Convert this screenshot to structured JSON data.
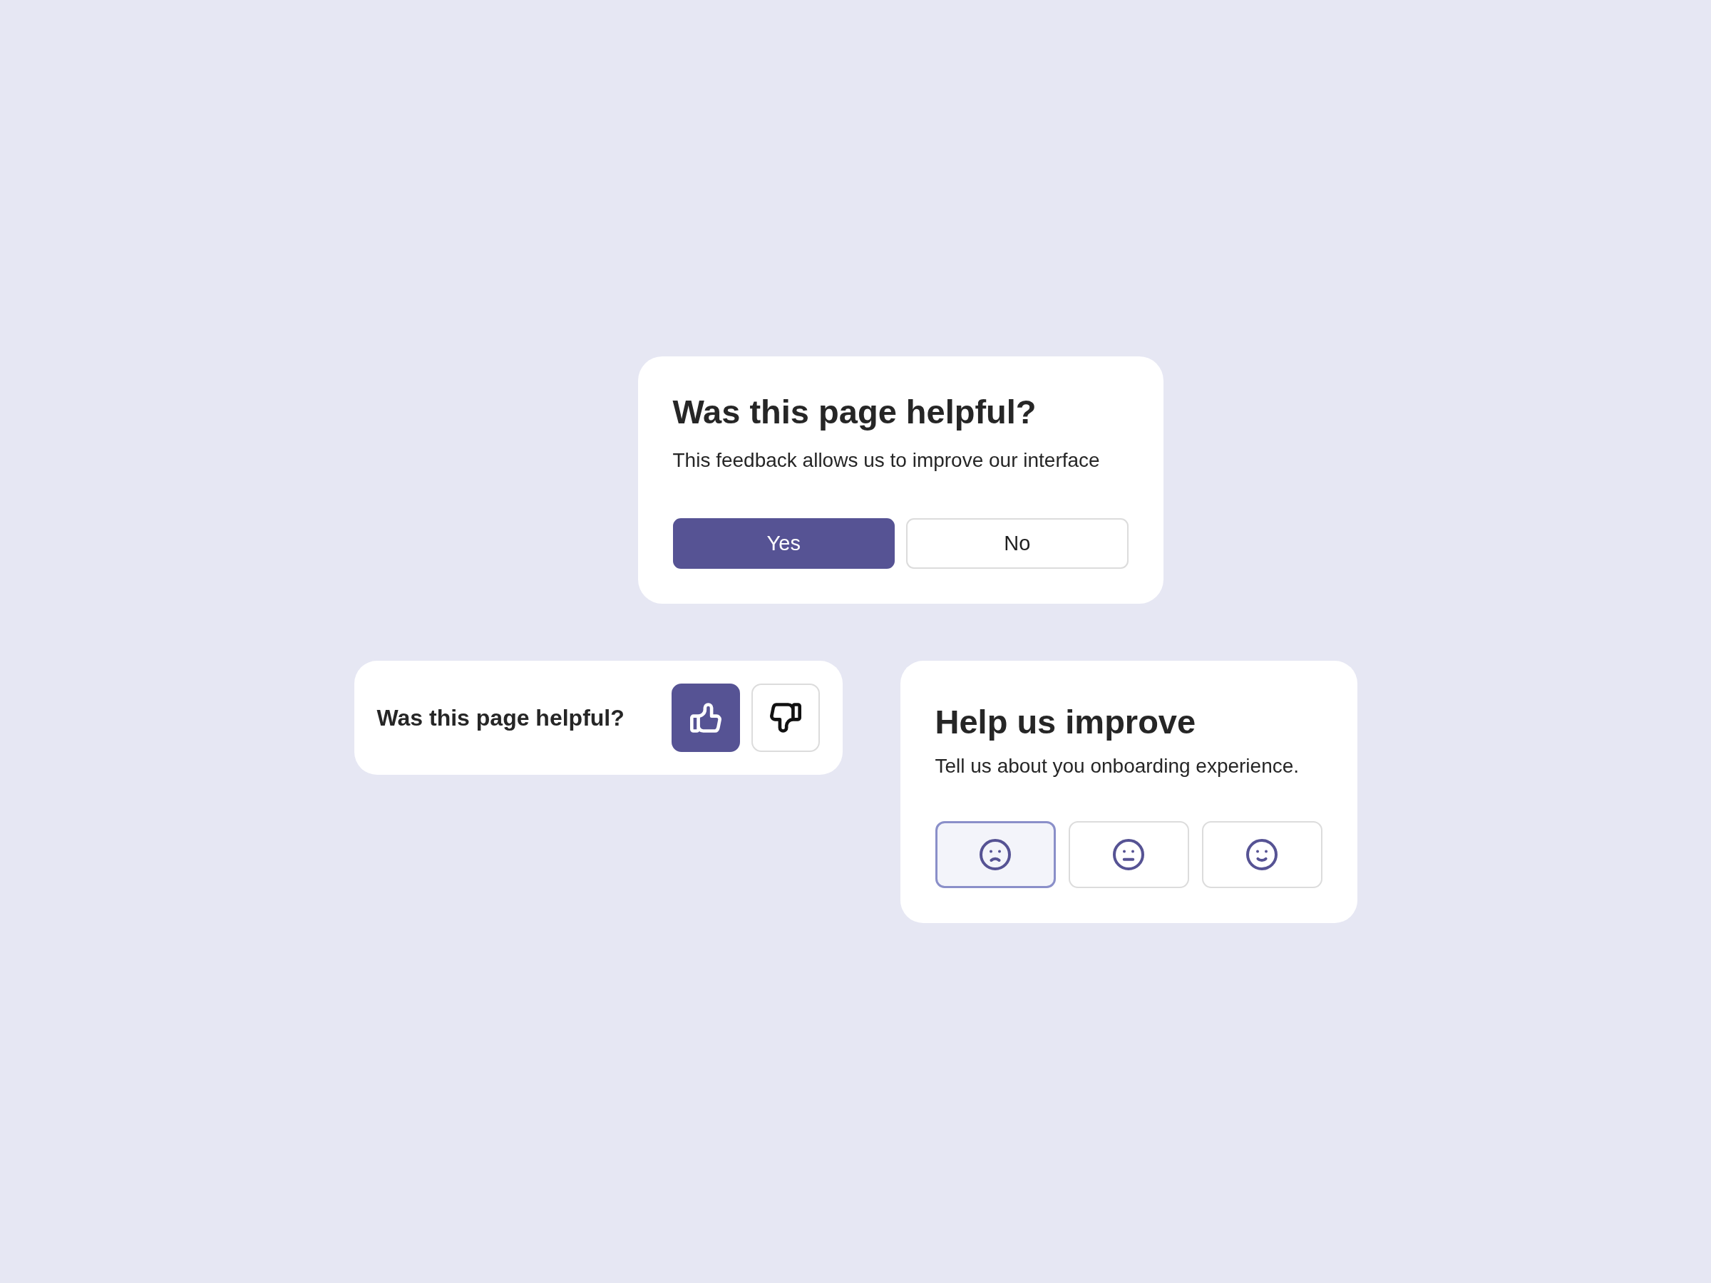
{
  "feedback_card": {
    "title": "Was this page helpful?",
    "subtitle": "This feedback allows us to improve our interface",
    "buttons": [
      {
        "label": "Yes",
        "selected": true
      },
      {
        "label": "No",
        "selected": false
      }
    ]
  },
  "compact_feedback": {
    "question": "Was this page helpful?",
    "buttons": [
      {
        "kind": "thumbs-up",
        "selected": true
      },
      {
        "kind": "thumbs-down",
        "selected": false
      }
    ]
  },
  "rating_card": {
    "title": "Help us improve",
    "subtitle": "Tell us about you onboarding experience.",
    "options": [
      {
        "kind": "sad",
        "selected": true
      },
      {
        "kind": "neutral",
        "selected": false
      },
      {
        "kind": "happy",
        "selected": false
      }
    ]
  }
}
